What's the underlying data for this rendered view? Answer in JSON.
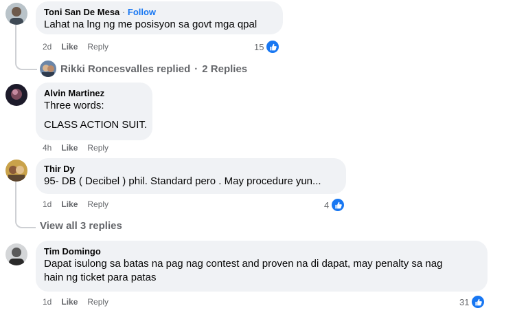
{
  "colors": {
    "bubble": "#f0f2f5",
    "link": "#1877f2",
    "muted": "#65676b",
    "thread": "#ced0d4",
    "like_badge": "#1877f2"
  },
  "comments": [
    {
      "author": "Toni San De Mesa",
      "separator": "·",
      "follow_label": "Follow",
      "lines": [
        "Lahat na lng ng me posisyon sa govt mga qpal"
      ],
      "time": "2d",
      "like_label": "Like",
      "reply_label": "Reply",
      "reactions": "15",
      "reaction_icon": "thumbs-up-icon",
      "replies_summary": {
        "name": "Rikki Roncesvalles replied",
        "separator": "·",
        "count": "2 Replies"
      }
    },
    {
      "author": "Alvin Martinez",
      "lines": [
        "Three words:",
        "CLASS ACTION SUIT."
      ],
      "time": "4h",
      "like_label": "Like",
      "reply_label": "Reply"
    },
    {
      "author": "Thir Dy",
      "lines": [
        "95- DB ( Decibel ) phil. Standard pero . May procedure yun..."
      ],
      "time": "1d",
      "like_label": "Like",
      "reply_label": "Reply",
      "reactions": "4",
      "reaction_icon": "thumbs-up-icon",
      "view_all": "View all 3 replies"
    },
    {
      "author": "Tim Domingo",
      "lines": [
        "Dapat isulong sa batas na pag nag contest and proven na di dapat, may penalty sa nag",
        "hain ng ticket para patas"
      ],
      "time": "1d",
      "like_label": "Like",
      "reply_label": "Reply",
      "reactions": "31",
      "reaction_icon": "thumbs-up-icon"
    }
  ]
}
